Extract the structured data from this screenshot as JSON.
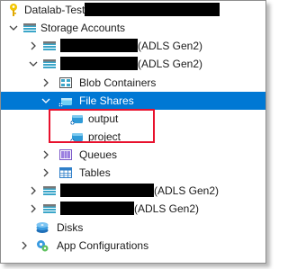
{
  "tree": {
    "subscription": {
      "label": "Datalab-Test"
    },
    "storage_accounts": {
      "label": "Storage Accounts"
    },
    "account1": {
      "suffix": "(ADLS Gen2)"
    },
    "account2": {
      "suffix": "(ADLS Gen2)"
    },
    "blob_containers": {
      "label": "Blob Containers"
    },
    "file_shares": {
      "label": "File Shares"
    },
    "share_output": {
      "label": "output"
    },
    "share_project": {
      "label": "project"
    },
    "queues": {
      "label": "Queues"
    },
    "tables": {
      "label": "Tables"
    },
    "account3": {
      "suffix": "(ADLS Gen2)"
    },
    "account4": {
      "suffix": "(ADLS Gen2)"
    },
    "disks": {
      "label": "Disks"
    },
    "app_configurations": {
      "label": "App Configurations"
    }
  },
  "colors": {
    "selection": "#0078d4",
    "highlight_box": "#e8112d",
    "key": "#f2c500",
    "storage_teal": "#3ba6c9",
    "share_blue": "#2f9bd8"
  }
}
